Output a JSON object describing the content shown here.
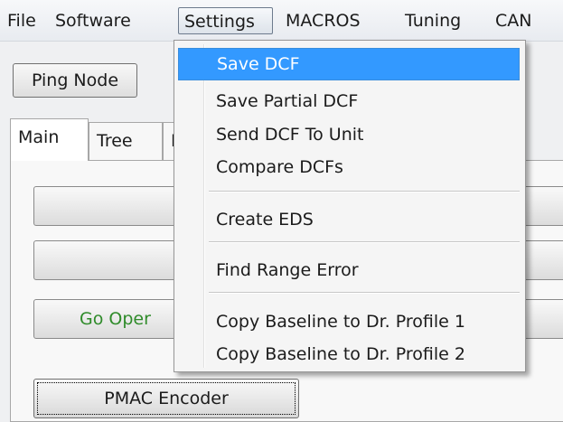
{
  "menubar": {
    "items": [
      "File",
      "Software",
      "Settings",
      "MACROS",
      "Tuning",
      "CAN"
    ]
  },
  "toolbar": {
    "ping_label": "Ping Node"
  },
  "tabs": [
    "Main",
    "Tree",
    "I"
  ],
  "main": {
    "go_oper_label": "Go Oper",
    "pmac_label": "PMAC Encoder"
  },
  "settings_menu": {
    "items": [
      "Save DCF",
      "Save Partial DCF",
      "Send DCF To Unit",
      "Compare DCFs",
      "Create EDS",
      "Find Range Error",
      "Copy Baseline to Dr. Profile 1",
      "Copy Baseline to Dr. Profile 2"
    ],
    "highlighted_color": "#3399ff"
  }
}
